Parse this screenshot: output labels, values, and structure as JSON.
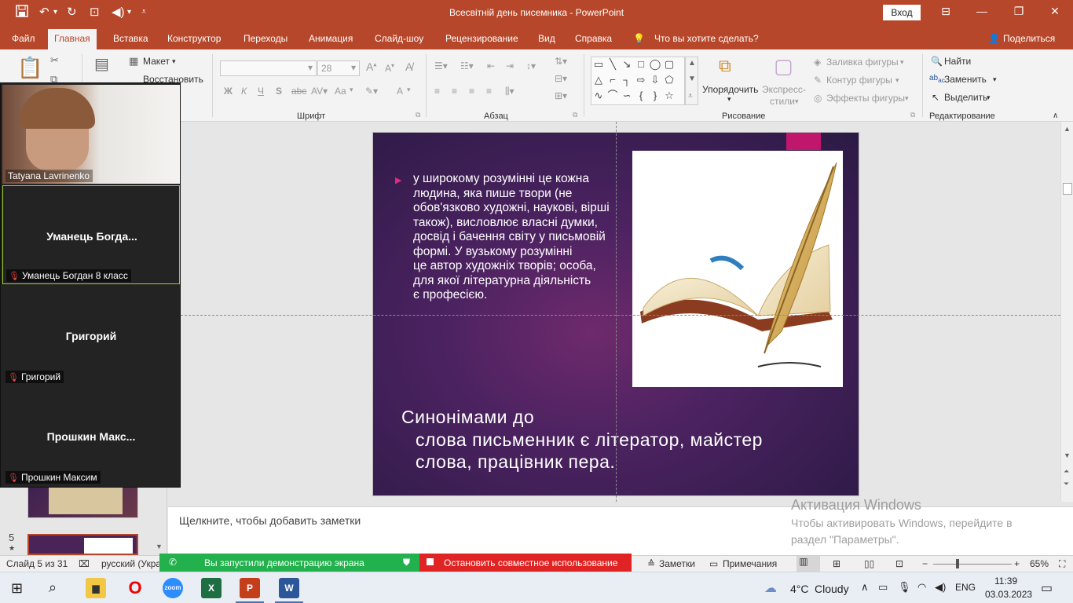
{
  "titlebar": {
    "title": "Всесвітній день писемника  -  PowerPoint",
    "login": "Вход"
  },
  "tabs": {
    "items": [
      "Файл",
      "Главная",
      "Вставка",
      "Конструктор",
      "Переходы",
      "Анимация",
      "Слайд-шоу",
      "Рецензирование",
      "Вид",
      "Справка",
      "Что вы хотите сделать?"
    ],
    "share": "Поделиться"
  },
  "ribbon": {
    "layout": "Макет",
    "restore": "Восстановить",
    "font_size": "28",
    "group_font": "Шрифт",
    "group_paragraph": "Абзац",
    "group_drawing": "Рисование",
    "group_editing": "Редактирование",
    "arrange": "Упорядочить",
    "quick_styles_1": "Экспресс-",
    "quick_styles_2": "стили",
    "shape_fill": "Заливка фигуры",
    "shape_outline": "Контур фигуры",
    "shape_effects": "Эффекты фигуры",
    "find": "Найти",
    "replace": "Заменить",
    "select": "Выделить",
    "bold": "Ж",
    "italic": "К",
    "underline": "Ч",
    "strike": "S",
    "font_color": "A",
    "case": "Aa"
  },
  "zoom": {
    "tiles": [
      {
        "name": "Tatyana Lavrinenko"
      },
      {
        "big": "Уманець  Богда...",
        "name": "Уманець Богдан 8 класс"
      },
      {
        "big": "Григорий",
        "name": "Григорий"
      },
      {
        "big": "Прошкин  Макс...",
        "name": "Прошкин Максим"
      }
    ]
  },
  "thumbs": {
    "num5": "5"
  },
  "slide": {
    "body_lines": [
      "у широкому розумінні це кожна",
      "людина, яка пише твори (не",
      "обов'язково художні, наукові, вірші",
      "також), висловлює власні думки,",
      "досвід і бачення світу у письмовій",
      "формі. У вузькому розумінні",
      "це автор художніх творів; особа,",
      "для якої літературна діяльність",
      "є професією."
    ],
    "syn_line1": "Синонімами  до",
    "syn_line2": "слова  письменник  є  літератор,  майстер",
    "syn_line3": "слова,  працівник  пера."
  },
  "notes": {
    "placeholder": "Щелкните, чтобы добавить заметки"
  },
  "watermark": {
    "title": "Активация Windows",
    "line1": "Чтобы активировать Windows, перейдите в",
    "line2": "раздел \"Параметры\"."
  },
  "status": {
    "slide_of": "Слайд 5 из 31",
    "language": "русский (Укра",
    "sharing": "Вы запустили демонстрацию экрана",
    "stop_share": "Остановить совместное использование",
    "notes": "Заметки",
    "comments": "Примечания",
    "zoom_level": "65%"
  },
  "taskbar": {
    "weather_temp": "4°C",
    "weather_text": "Cloudy",
    "lang": "ENG",
    "time": "11:39",
    "date": "03.03.2023",
    "zoom_label": "zoom"
  },
  "colors": {
    "accent": "#b7472a",
    "slide_accent": "#c0166c"
  }
}
